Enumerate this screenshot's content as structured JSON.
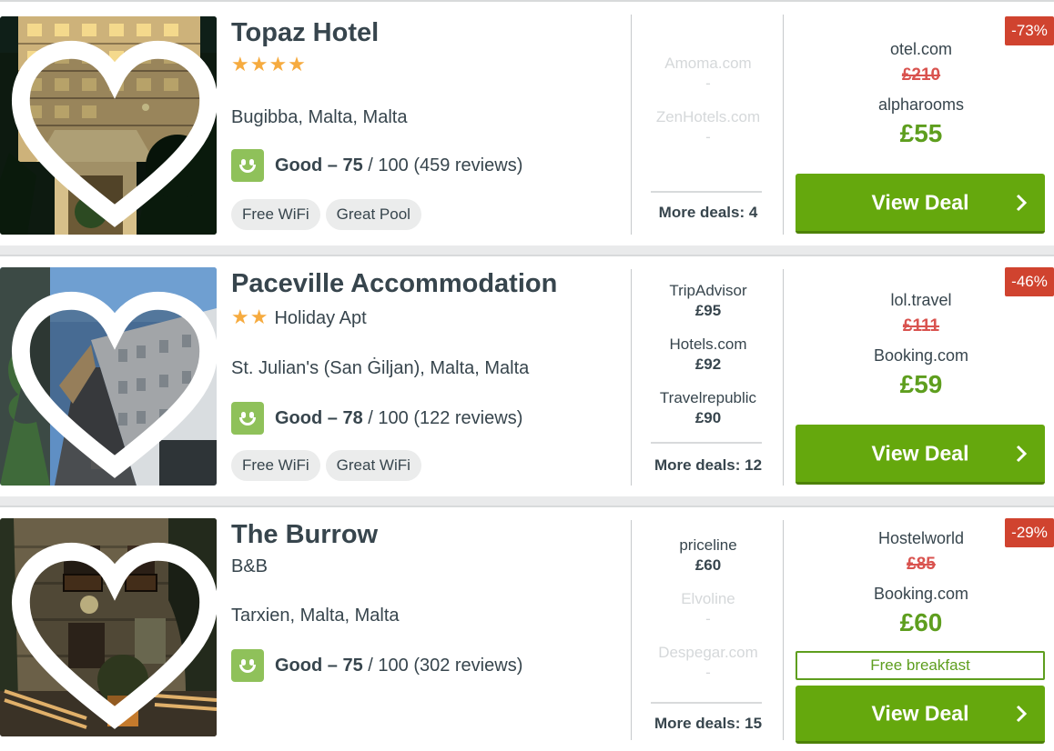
{
  "colors": {
    "accent_green": "#65a80d",
    "price_green": "#5e9e1e",
    "discount_red": "#d0432f",
    "star_orange": "#f6ab3f",
    "rating_green": "#8fc15a"
  },
  "icons": {
    "favorite": "heart-outline-icon",
    "rating": "smiley-face-icon",
    "button_arrow": "chevron-right-icon"
  },
  "hotels": [
    {
      "name": "Topaz Hotel",
      "stars": "★★★★",
      "star_count": 4,
      "type": "",
      "location": "Bugibba, Malta, Malta",
      "rating_word": "Good",
      "rating_score": "75",
      "rating_rest": " / 100 (459 reviews)",
      "amenities": [
        "Free WiFi",
        "Great Pool"
      ],
      "deals": [
        {
          "provider": "Amoma.com",
          "price": "-",
          "faded": true
        },
        {
          "provider": "ZenHotels.com",
          "price": "-",
          "faded": true
        }
      ],
      "more_deals": "More deals: 4",
      "best": {
        "compare_site": "otel.com",
        "old_price": "£210",
        "site": "alpharooms",
        "price": "£55",
        "discount": "-73%"
      },
      "view_deal": "View Deal"
    },
    {
      "name": "Paceville Accommodation",
      "stars": "★★",
      "star_count": 2,
      "type": "Holiday Apt",
      "location": "St. Julian's (San Ġiljan), Malta, Malta",
      "rating_word": "Good",
      "rating_score": "78",
      "rating_rest": " / 100 (122 reviews)",
      "amenities": [
        "Free WiFi",
        "Great WiFi"
      ],
      "deals": [
        {
          "provider": "TripAdvisor",
          "price": "£95",
          "faded": false
        },
        {
          "provider": "Hotels.com",
          "price": "£92",
          "faded": false
        },
        {
          "provider": "Travelrepublic",
          "price": "£90",
          "faded": false
        }
      ],
      "more_deals": "More deals: 12",
      "best": {
        "compare_site": "lol.travel",
        "old_price": "£111",
        "site": "Booking.com",
        "price": "£59",
        "discount": "-46%"
      },
      "view_deal": "View Deal"
    },
    {
      "name": "The Burrow",
      "stars": "",
      "star_count": 0,
      "type": "B&B",
      "location": "Tarxien, Malta, Malta",
      "rating_word": "Good",
      "rating_score": "75",
      "rating_rest": " / 100 (302 reviews)",
      "amenities": [],
      "deals": [
        {
          "provider": "priceline",
          "price": "£60",
          "faded": false
        },
        {
          "provider": "Elvoline",
          "price": "-",
          "faded": true
        },
        {
          "provider": "Despegar.com",
          "price": "-",
          "faded": true
        }
      ],
      "more_deals": "More deals: 15",
      "best": {
        "compare_site": "Hostelworld",
        "old_price": "£85",
        "site": "Booking.com",
        "price": "£60",
        "discount": "-29%",
        "perk": "Free breakfast"
      },
      "view_deal": "View Deal"
    }
  ]
}
